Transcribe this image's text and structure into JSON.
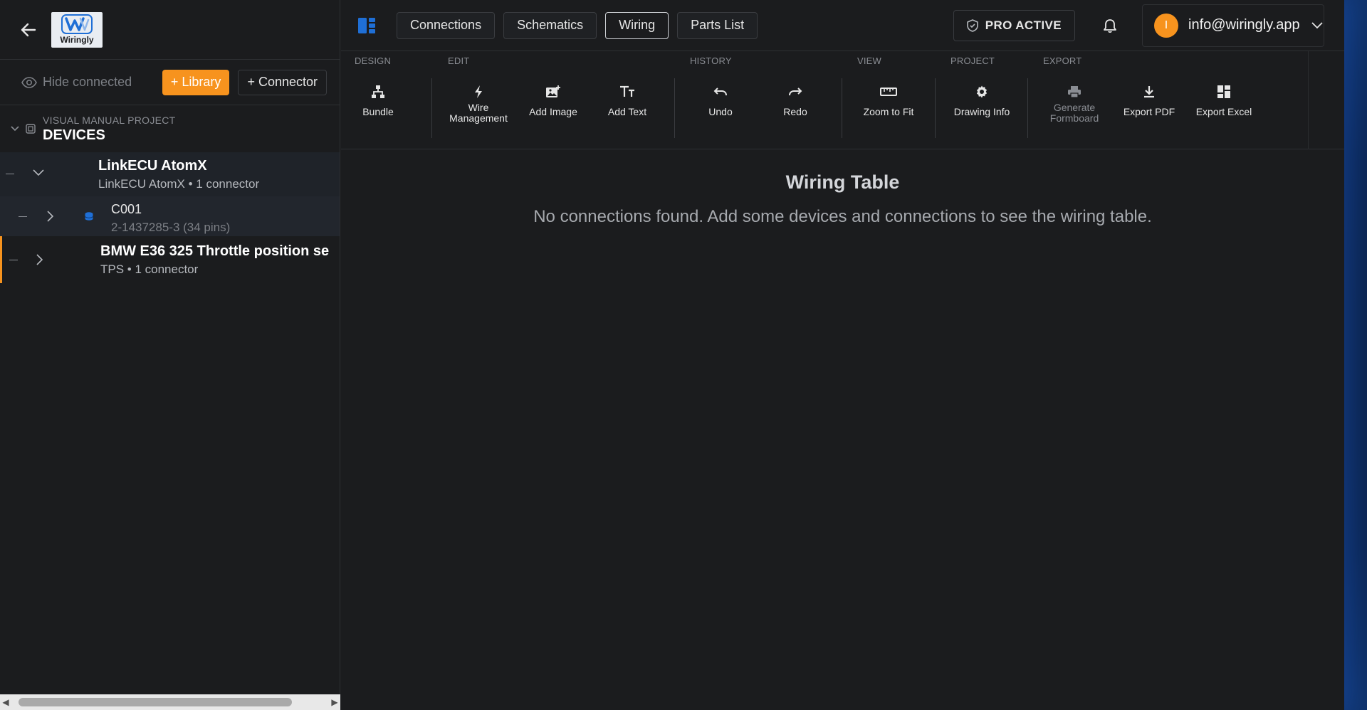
{
  "sidebar": {
    "logo_text": "Wiringly",
    "hide_connected": "Hide connected",
    "library_button": "+ Library",
    "connector_button": "+ Connector",
    "project": {
      "subtitle": "VISUAL MANUAL PROJECT",
      "title": "DEVICES"
    },
    "devices": [
      {
        "title": "LinkECU AtomX",
        "subtitle": "LinkECU AtomX • 1 connector",
        "connectors": [
          {
            "title": "C001",
            "subtitle": "2-1437285-3 (34 pins)"
          }
        ]
      },
      {
        "title": "BMW E36 325 Throttle position se",
        "subtitle": "TPS • 1 connector"
      }
    ]
  },
  "topbar": {
    "tabs": [
      "Connections",
      "Schematics",
      "Wiring",
      "Parts List"
    ],
    "active_tab": "Wiring",
    "pro_badge": "PRO ACTIVE",
    "avatar_letter": "I",
    "account_email": "info@wiringly.app"
  },
  "ribbon": {
    "groups": {
      "design": "DESIGN",
      "edit": "EDIT",
      "history": "HISTORY",
      "view": "VIEW",
      "project": "PROJECT",
      "export": "EXPORT"
    },
    "tools": {
      "bundle": "Bundle",
      "wire_management_1": "Wire",
      "wire_management_2": "Management",
      "add_image": "Add Image",
      "add_text": "Add Text",
      "undo": "Undo",
      "redo": "Redo",
      "zoom_to_fit": "Zoom to Fit",
      "drawing_info": "Drawing Info",
      "generate_formboard_1": "Generate",
      "generate_formboard_2": "Formboard",
      "export_pdf": "Export PDF",
      "export_excel": "Export Excel"
    }
  },
  "main": {
    "title": "Wiring Table",
    "message": "No connections found. Add some devices and connections to see the wiring table."
  },
  "colors": {
    "accent_orange": "#f7931e",
    "brand_blue": "#1f6fd6",
    "background": "#1b1c1e"
  }
}
